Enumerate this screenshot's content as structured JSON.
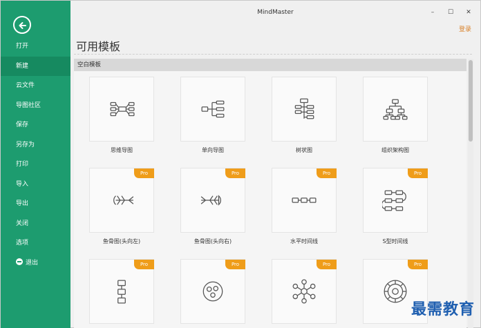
{
  "window": {
    "title": "MindMaster",
    "minimize": "–",
    "maximize": "☐",
    "close": "✕"
  },
  "header": {
    "login": "登录",
    "page_title": "可用模板"
  },
  "sidebar": {
    "items": [
      {
        "label": "打开"
      },
      {
        "label": "新建"
      },
      {
        "label": "云文件"
      },
      {
        "label": "导图社区"
      },
      {
        "label": "保存"
      },
      {
        "label": "另存为"
      },
      {
        "label": "打印"
      },
      {
        "label": "导入"
      },
      {
        "label": "导出"
      },
      {
        "label": "关闭"
      },
      {
        "label": "选项"
      },
      {
        "label": "退出"
      }
    ],
    "active": "新建"
  },
  "section": {
    "title": "空白模板"
  },
  "templates": [
    {
      "label": "思维导图",
      "icon": "mind-map-icon",
      "pro": false
    },
    {
      "label": "单向导图",
      "icon": "right-map-icon",
      "pro": false
    },
    {
      "label": "树状图",
      "icon": "tree-chart-icon",
      "pro": false
    },
    {
      "label": "组织架构图",
      "icon": "org-chart-icon",
      "pro": false
    },
    {
      "label": "鱼骨图(头向左)",
      "icon": "fishbone-left-icon",
      "pro": true
    },
    {
      "label": "鱼骨图(头向右)",
      "icon": "fishbone-right-icon",
      "pro": true
    },
    {
      "label": "水平时间线",
      "icon": "horizontal-timeline-icon",
      "pro": true
    },
    {
      "label": "S型时间线",
      "icon": "s-timeline-icon",
      "pro": true
    },
    {
      "label": "",
      "icon": "vertical-timeline-icon",
      "pro": true
    },
    {
      "label": "",
      "icon": "bubble-map-icon",
      "pro": true
    },
    {
      "label": "",
      "icon": "network-map-icon",
      "pro": true
    },
    {
      "label": "",
      "icon": "circle-map-icon",
      "pro": true
    }
  ],
  "pro_badge": "Pro",
  "watermark": "最需教育",
  "colors": {
    "sidebar": "#1d9c6f",
    "sidebar_active": "#168a60",
    "pro_badge": "#ef9d1a",
    "login": "#d9822b",
    "watermark": "#1f5fb0"
  }
}
